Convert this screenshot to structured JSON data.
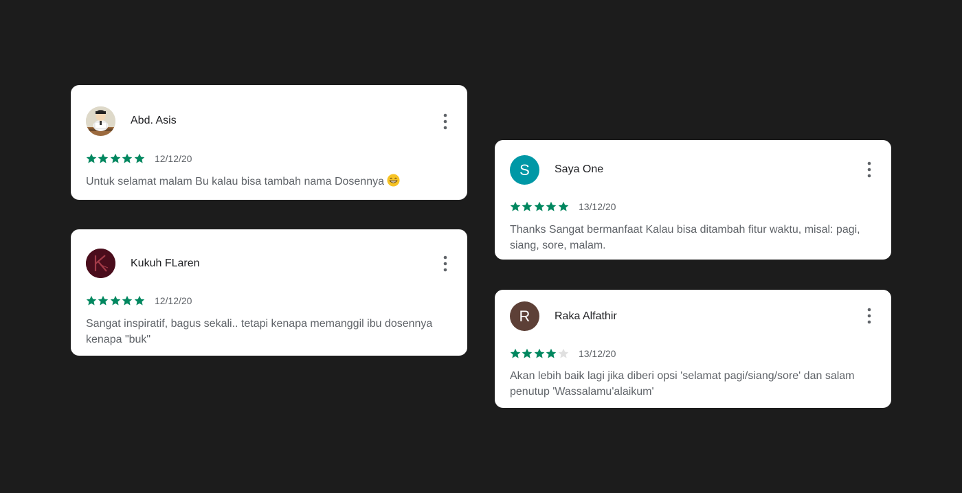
{
  "colors": {
    "background": "#1c1c1c",
    "card": "#ffffff",
    "star_filled": "#01875f",
    "star_empty": "#e0e0e0",
    "name": "#202124",
    "secondary_text": "#5f6368"
  },
  "reviews": [
    {
      "author": "Abd. Asis",
      "avatar": {
        "type": "image",
        "icon": "cartoon-avatar-icon"
      },
      "rating": 5,
      "date": "12/12/20",
      "text": "Untuk selamat malam Bu kalau bisa tambah nama Dosennya",
      "emoji": "grinning-face-icon"
    },
    {
      "author": "Kukuh FLaren",
      "avatar": {
        "type": "image",
        "icon": "k-logo-avatar-icon",
        "color": "#4a0d1c"
      },
      "rating": 5,
      "date": "12/12/20",
      "text": "Sangat inspiratif, bagus sekali.. tetapi kenapa memanggil ibu dosennya kenapa \"buk\""
    },
    {
      "author": "Saya One",
      "avatar": {
        "type": "letter",
        "letter": "S",
        "color": "#0098a6"
      },
      "rating": 5,
      "date": "13/12/20",
      "text": "Thanks Sangat bermanfaat Kalau bisa ditambah fitur waktu, misal: pagi, siang, sore, malam."
    },
    {
      "author": "Raka Alfathir",
      "avatar": {
        "type": "letter",
        "letter": "R",
        "color": "#5d4037"
      },
      "rating": 4,
      "date": "13/12/20",
      "text": "Akan lebih baik lagi jika diberi opsi 'selamat pagi/siang/sore' dan salam penutup 'Wassalamu'alaikum'"
    }
  ]
}
